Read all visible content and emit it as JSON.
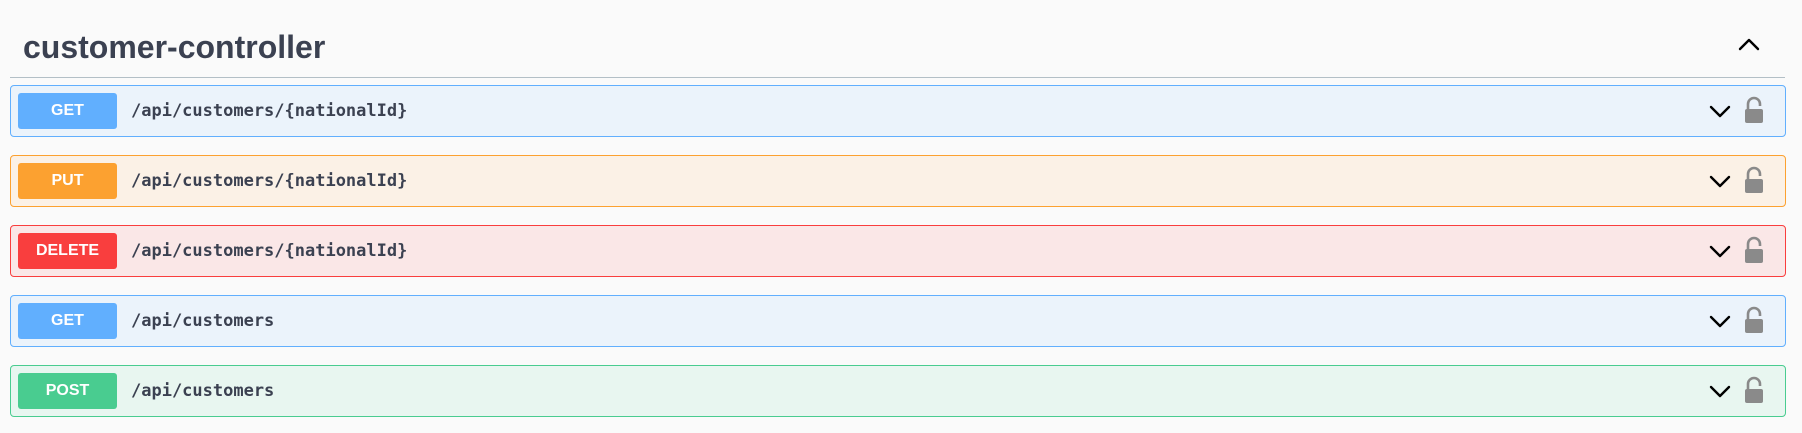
{
  "section": {
    "title": "customer-controller",
    "toggle_icon": "chevron-up-icon"
  },
  "operations": [
    {
      "method": "GET",
      "path": "/api/customers/{nationalId}",
      "color": "#61affe"
    },
    {
      "method": "PUT",
      "path": "/api/customers/{nationalId}",
      "color": "#fca130"
    },
    {
      "method": "DELETE",
      "path": "/api/customers/{nationalId}",
      "color": "#f93e3e"
    },
    {
      "method": "GET",
      "path": "/api/customers",
      "color": "#61affe"
    },
    {
      "method": "POST",
      "path": "/api/customers",
      "color": "#49cc90"
    }
  ],
  "icons": {
    "expand": "chevron-down-icon",
    "auth": "lock-icon"
  }
}
